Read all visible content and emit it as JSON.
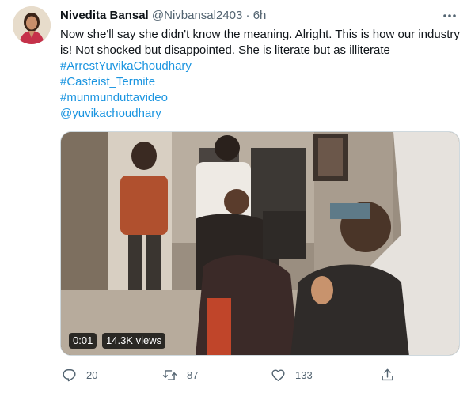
{
  "tweet": {
    "author_name": "Nivedita Bansal",
    "author_handle": "@Nivbansal2403",
    "separator": "·",
    "time": "6h",
    "text_lines": [
      "Now she'll say she didn't know the meaning. Alright. This is how our industry",
      "is! Not shocked but disappointed. She is literate but as illiterate"
    ],
    "hashtags": [
      "#ArrestYuvikaChoudhary",
      "#Casteist_Termite",
      "#munmunduttavideo",
      "@yuvikachoudhary"
    ]
  },
  "video": {
    "duration": "0:01",
    "views": "14.3K views"
  },
  "actions": {
    "reply_count": "20",
    "retweet_count": "87",
    "like_count": "133"
  },
  "icons": [
    "more-icon",
    "reply-icon",
    "retweet-icon",
    "like-icon",
    "share-icon"
  ],
  "colors": {
    "link": "#1b95e0",
    "secondary": "#536471",
    "text": "#0f1419"
  }
}
